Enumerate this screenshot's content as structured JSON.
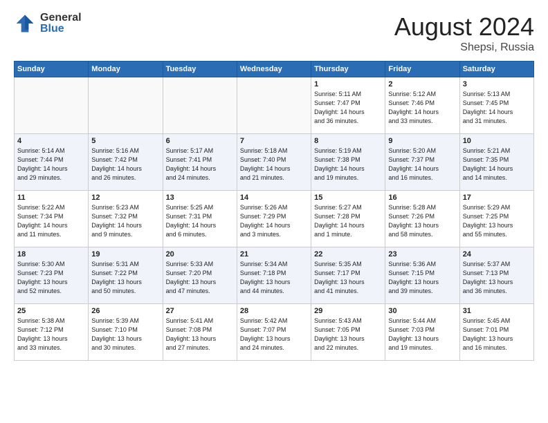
{
  "header": {
    "logo_general": "General",
    "logo_blue": "Blue",
    "month_year": "August 2024",
    "location": "Shepsi, Russia"
  },
  "weekdays": [
    "Sunday",
    "Monday",
    "Tuesday",
    "Wednesday",
    "Thursday",
    "Friday",
    "Saturday"
  ],
  "weeks": [
    [
      {
        "day": "",
        "info": ""
      },
      {
        "day": "",
        "info": ""
      },
      {
        "day": "",
        "info": ""
      },
      {
        "day": "",
        "info": ""
      },
      {
        "day": "1",
        "info": "Sunrise: 5:11 AM\nSunset: 7:47 PM\nDaylight: 14 hours\nand 36 minutes."
      },
      {
        "day": "2",
        "info": "Sunrise: 5:12 AM\nSunset: 7:46 PM\nDaylight: 14 hours\nand 33 minutes."
      },
      {
        "day": "3",
        "info": "Sunrise: 5:13 AM\nSunset: 7:45 PM\nDaylight: 14 hours\nand 31 minutes."
      }
    ],
    [
      {
        "day": "4",
        "info": "Sunrise: 5:14 AM\nSunset: 7:44 PM\nDaylight: 14 hours\nand 29 minutes."
      },
      {
        "day": "5",
        "info": "Sunrise: 5:16 AM\nSunset: 7:42 PM\nDaylight: 14 hours\nand 26 minutes."
      },
      {
        "day": "6",
        "info": "Sunrise: 5:17 AM\nSunset: 7:41 PM\nDaylight: 14 hours\nand 24 minutes."
      },
      {
        "day": "7",
        "info": "Sunrise: 5:18 AM\nSunset: 7:40 PM\nDaylight: 14 hours\nand 21 minutes."
      },
      {
        "day": "8",
        "info": "Sunrise: 5:19 AM\nSunset: 7:38 PM\nDaylight: 14 hours\nand 19 minutes."
      },
      {
        "day": "9",
        "info": "Sunrise: 5:20 AM\nSunset: 7:37 PM\nDaylight: 14 hours\nand 16 minutes."
      },
      {
        "day": "10",
        "info": "Sunrise: 5:21 AM\nSunset: 7:35 PM\nDaylight: 14 hours\nand 14 minutes."
      }
    ],
    [
      {
        "day": "11",
        "info": "Sunrise: 5:22 AM\nSunset: 7:34 PM\nDaylight: 14 hours\nand 11 minutes."
      },
      {
        "day": "12",
        "info": "Sunrise: 5:23 AM\nSunset: 7:32 PM\nDaylight: 14 hours\nand 9 minutes."
      },
      {
        "day": "13",
        "info": "Sunrise: 5:25 AM\nSunset: 7:31 PM\nDaylight: 14 hours\nand 6 minutes."
      },
      {
        "day": "14",
        "info": "Sunrise: 5:26 AM\nSunset: 7:29 PM\nDaylight: 14 hours\nand 3 minutes."
      },
      {
        "day": "15",
        "info": "Sunrise: 5:27 AM\nSunset: 7:28 PM\nDaylight: 14 hours\nand 1 minute."
      },
      {
        "day": "16",
        "info": "Sunrise: 5:28 AM\nSunset: 7:26 PM\nDaylight: 13 hours\nand 58 minutes."
      },
      {
        "day": "17",
        "info": "Sunrise: 5:29 AM\nSunset: 7:25 PM\nDaylight: 13 hours\nand 55 minutes."
      }
    ],
    [
      {
        "day": "18",
        "info": "Sunrise: 5:30 AM\nSunset: 7:23 PM\nDaylight: 13 hours\nand 52 minutes."
      },
      {
        "day": "19",
        "info": "Sunrise: 5:31 AM\nSunset: 7:22 PM\nDaylight: 13 hours\nand 50 minutes."
      },
      {
        "day": "20",
        "info": "Sunrise: 5:33 AM\nSunset: 7:20 PM\nDaylight: 13 hours\nand 47 minutes."
      },
      {
        "day": "21",
        "info": "Sunrise: 5:34 AM\nSunset: 7:18 PM\nDaylight: 13 hours\nand 44 minutes."
      },
      {
        "day": "22",
        "info": "Sunrise: 5:35 AM\nSunset: 7:17 PM\nDaylight: 13 hours\nand 41 minutes."
      },
      {
        "day": "23",
        "info": "Sunrise: 5:36 AM\nSunset: 7:15 PM\nDaylight: 13 hours\nand 39 minutes."
      },
      {
        "day": "24",
        "info": "Sunrise: 5:37 AM\nSunset: 7:13 PM\nDaylight: 13 hours\nand 36 minutes."
      }
    ],
    [
      {
        "day": "25",
        "info": "Sunrise: 5:38 AM\nSunset: 7:12 PM\nDaylight: 13 hours\nand 33 minutes."
      },
      {
        "day": "26",
        "info": "Sunrise: 5:39 AM\nSunset: 7:10 PM\nDaylight: 13 hours\nand 30 minutes."
      },
      {
        "day": "27",
        "info": "Sunrise: 5:41 AM\nSunset: 7:08 PM\nDaylight: 13 hours\nand 27 minutes."
      },
      {
        "day": "28",
        "info": "Sunrise: 5:42 AM\nSunset: 7:07 PM\nDaylight: 13 hours\nand 24 minutes."
      },
      {
        "day": "29",
        "info": "Sunrise: 5:43 AM\nSunset: 7:05 PM\nDaylight: 13 hours\nand 22 minutes."
      },
      {
        "day": "30",
        "info": "Sunrise: 5:44 AM\nSunset: 7:03 PM\nDaylight: 13 hours\nand 19 minutes."
      },
      {
        "day": "31",
        "info": "Sunrise: 5:45 AM\nSunset: 7:01 PM\nDaylight: 13 hours\nand 16 minutes."
      }
    ]
  ]
}
